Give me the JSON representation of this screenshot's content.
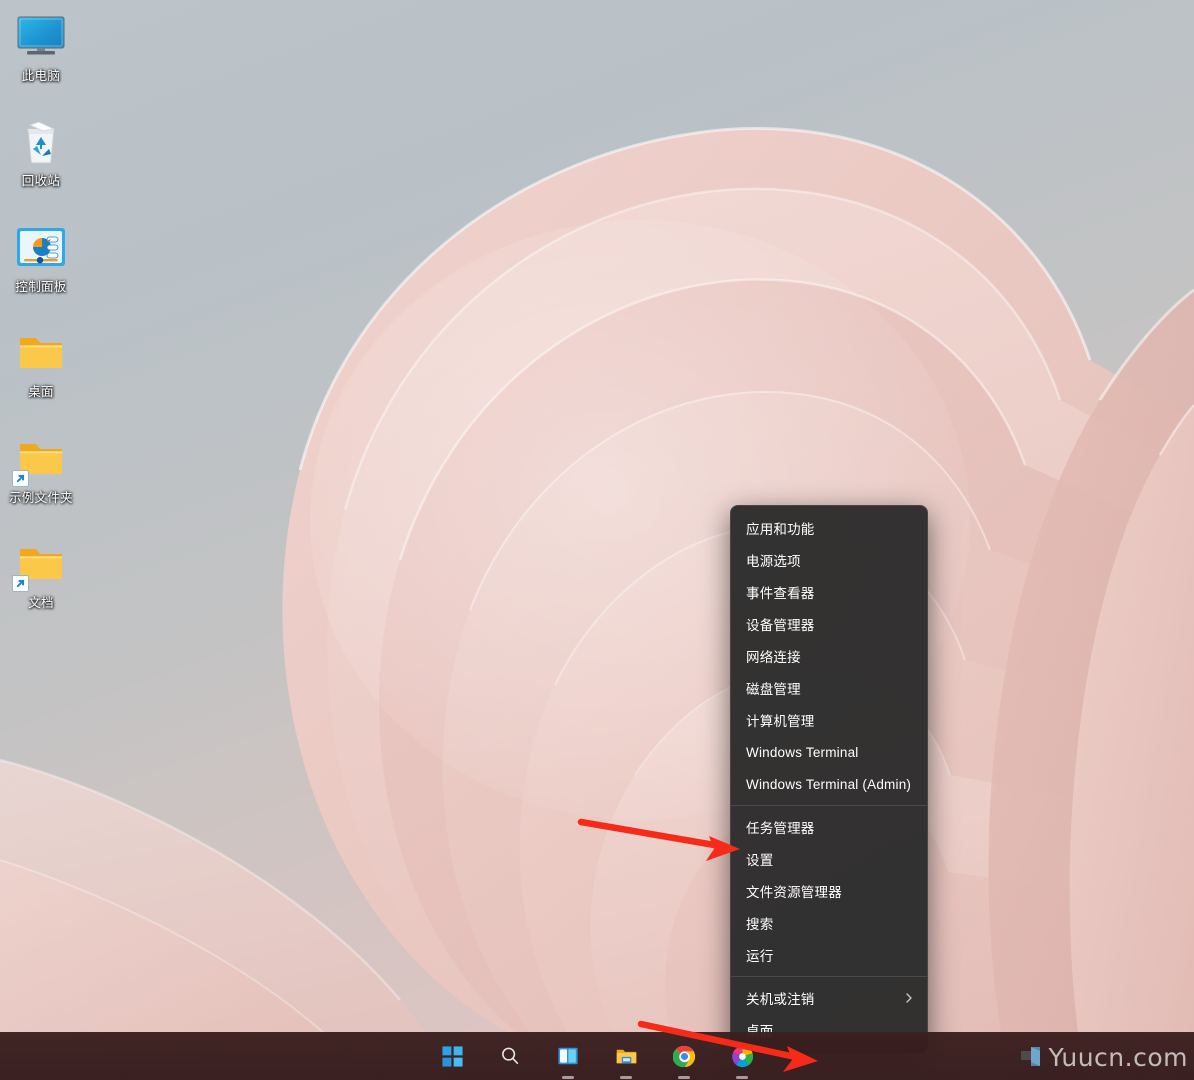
{
  "desktop": {
    "icons": [
      {
        "label": "此电脑",
        "icon": "this-pc-icon",
        "shortcut": false
      },
      {
        "label": "回收站",
        "icon": "recycle-bin-icon",
        "shortcut": false
      },
      {
        "label": "控制面板",
        "icon": "control-panel-icon",
        "shortcut": false
      },
      {
        "label": "桌面",
        "icon": "folder-icon",
        "shortcut": false
      },
      {
        "label": "示例文件夹",
        "icon": "folder-shortcut-icon",
        "shortcut": true
      },
      {
        "label": "文档",
        "icon": "folder-shortcut-icon",
        "shortcut": true
      }
    ]
  },
  "context_menu": {
    "groups": [
      {
        "items": [
          {
            "label": "应用和功能",
            "submenu": false
          },
          {
            "label": "电源选项",
            "submenu": false
          },
          {
            "label": "事件查看器",
            "submenu": false
          },
          {
            "label": "设备管理器",
            "submenu": false
          },
          {
            "label": "网络连接",
            "submenu": false
          },
          {
            "label": "磁盘管理",
            "submenu": false
          },
          {
            "label": "计算机管理",
            "submenu": false
          },
          {
            "label": "Windows Terminal",
            "submenu": false
          },
          {
            "label": "Windows Terminal (Admin)",
            "submenu": false
          }
        ]
      },
      {
        "items": [
          {
            "label": "任务管理器",
            "submenu": false
          },
          {
            "label": "设置",
            "submenu": false
          },
          {
            "label": "文件资源管理器",
            "submenu": false
          },
          {
            "label": "搜索",
            "submenu": false
          },
          {
            "label": "运行",
            "submenu": false
          }
        ]
      },
      {
        "items": [
          {
            "label": "关机或注销",
            "submenu": true
          },
          {
            "label": "桌面",
            "submenu": false
          }
        ]
      }
    ]
  },
  "taskbar": {
    "buttons": [
      {
        "name": "start-button",
        "icon": "windows-logo-icon",
        "running": false
      },
      {
        "name": "search-button",
        "icon": "search-icon",
        "running": false
      },
      {
        "name": "task-view-button",
        "icon": "task-view-icon",
        "running": true
      },
      {
        "name": "file-explorer-button",
        "icon": "folder-icon",
        "running": true
      },
      {
        "name": "chrome-button",
        "icon": "chrome-icon",
        "running": true
      },
      {
        "name": "photos-button",
        "icon": "photos-icon",
        "running": true
      }
    ]
  },
  "annotations": {
    "color": "#f52a18",
    "arrows": [
      {
        "name": "arrow-to-settings",
        "target": "设置"
      },
      {
        "name": "arrow-to-start-button",
        "target": "start-button"
      }
    ]
  },
  "watermark": {
    "text": "Yuucn.com"
  },
  "colors": {
    "menu_background": "#2b2b2b",
    "menu_text": "#ffffff",
    "taskbar_background": "#3a1f1e",
    "accent": "#f52a18",
    "wallpaper_pink": "#e8c4bf",
    "wallpaper_gray": "#b9c1c7"
  }
}
